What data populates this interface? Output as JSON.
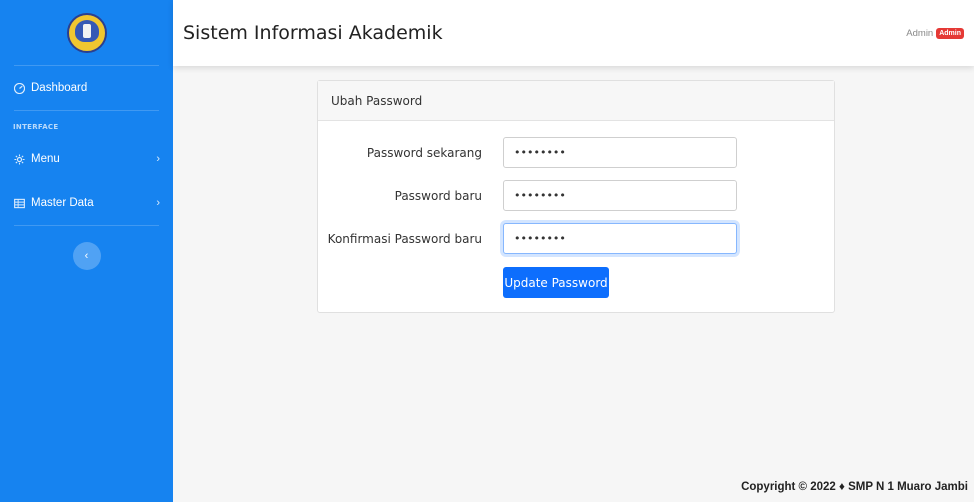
{
  "sidebar": {
    "logo_icon": "school-emblem",
    "dashboard_label": "Dashboard",
    "heading": "INTERFACE",
    "menu_label": "Menu",
    "master_data_label": "Master Data",
    "toggle_icon": "chevron-left-icon"
  },
  "header": {
    "title": "Sistem Informasi Akademik",
    "user_name": "Admin",
    "user_badge": "Admin"
  },
  "card": {
    "title": "Ubah Password",
    "fields": [
      {
        "label": "Password sekarang",
        "value": "password"
      },
      {
        "label": "Password baru",
        "value": "password"
      },
      {
        "label": "Konfirmasi Password baru",
        "value": "password"
      }
    ],
    "submit_label": "Update Password"
  },
  "footer": {
    "text": "Copyright © 2022 ♦ SMP N 1 Muaro Jambi"
  },
  "colors": {
    "sidebar": "#1683f0",
    "primary": "#0d6efd",
    "badge": "#e53935"
  }
}
